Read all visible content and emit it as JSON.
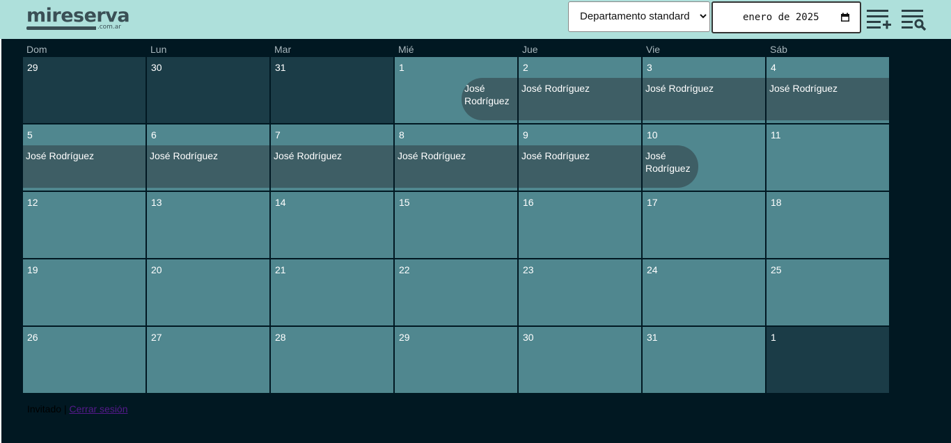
{
  "logo": {
    "main": "mireserva",
    "sub": ".com.ar"
  },
  "toolbar": {
    "property_select": "Departamento standard",
    "date_value": "enero de 2025"
  },
  "weekdays": [
    "Dom",
    "Lun",
    "Mar",
    "Mié",
    "Jue",
    "Vie",
    "Sáb"
  ],
  "weeks": [
    [
      "29",
      "30",
      "31",
      "1",
      "2",
      "3",
      "4"
    ],
    [
      "5",
      "6",
      "7",
      "8",
      "9",
      "10",
      "11"
    ],
    [
      "12",
      "13",
      "14",
      "15",
      "16",
      "17",
      "18"
    ],
    [
      "19",
      "20",
      "21",
      "22",
      "23",
      "24",
      "25"
    ],
    [
      "26",
      "27",
      "28",
      "29",
      "30",
      "31",
      "1"
    ]
  ],
  "event_name": "José Rodríguez",
  "footer": {
    "user": "Invitado",
    "separator": "|",
    "logout": "Cerrar sesión"
  }
}
